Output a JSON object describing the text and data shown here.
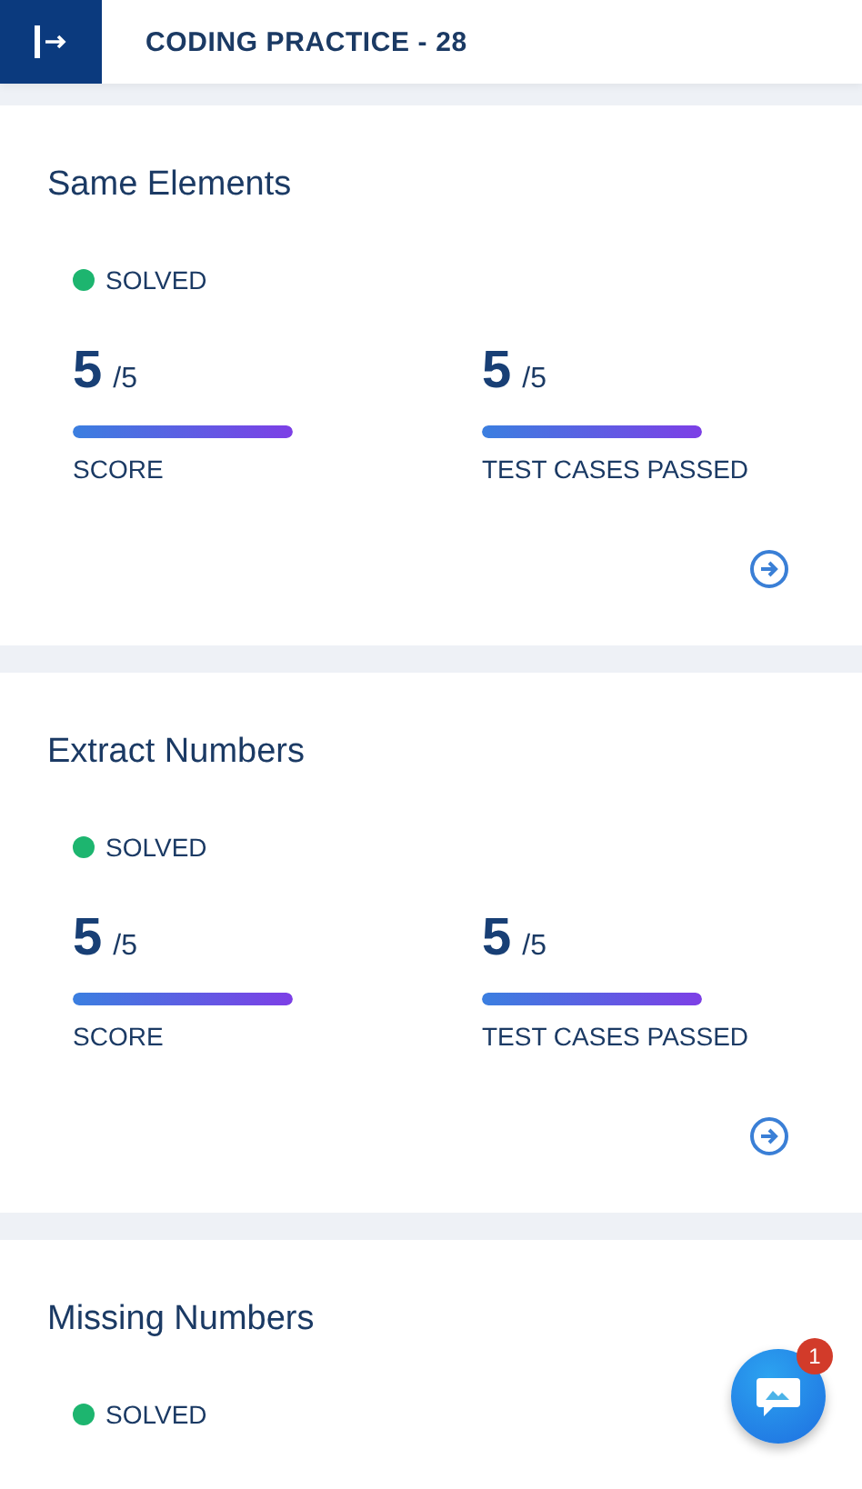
{
  "header": {
    "title": "CODING PRACTICE - 28"
  },
  "problems": [
    {
      "title": "Same Elements",
      "status": "SOLVED",
      "color": "#1db56f",
      "metrics": [
        {
          "value": "5",
          "total": "/5",
          "level": 1,
          "label": "SCORE"
        },
        {
          "value": "5",
          "total": "/5",
          "level": 1,
          "label": "TEST CASES PASSED"
        }
      ]
    },
    {
      "title": "Extract Numbers",
      "status": "SOLVED",
      "color": "#1db56f",
      "metrics": [
        {
          "value": "5",
          "total": "/5",
          "level": 1,
          "label": "SCORE"
        },
        {
          "value": "5",
          "total": "/5",
          "level": 1,
          "label": "TEST CASES PASSED"
        }
      ]
    },
    {
      "title": "Missing Numbers",
      "status": "SOLVED",
      "color": "#1db56f"
    }
  ],
  "chat": {
    "badge": "1"
  }
}
